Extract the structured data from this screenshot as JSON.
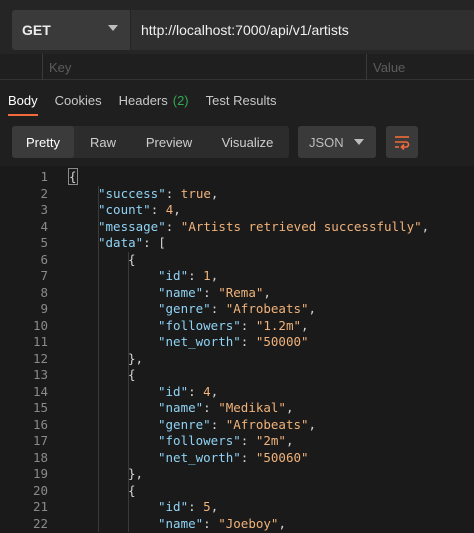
{
  "request": {
    "method": "GET",
    "url": "http://localhost:7000/api/v1/artists"
  },
  "params": {
    "key_placeholder": "Key",
    "value_placeholder": "Value"
  },
  "tabs": [
    {
      "label": "Body",
      "active": true
    },
    {
      "label": "Cookies",
      "active": false
    },
    {
      "label": "Headers",
      "count": "(2)",
      "active": false
    },
    {
      "label": "Test Results",
      "active": false
    }
  ],
  "view_modes": [
    {
      "label": "Pretty",
      "active": true
    },
    {
      "label": "Raw",
      "active": false
    },
    {
      "label": "Preview",
      "active": false
    },
    {
      "label": "Visualize",
      "active": false
    }
  ],
  "format": {
    "selected": "JSON"
  },
  "colors": {
    "accent": "#f26b3a",
    "headers_count": "#34a853",
    "json_key": "#8fd3f4",
    "json_value": "#f0b27a"
  },
  "icons": {
    "wrap": "wrap-lines-icon",
    "method_dropdown": "chevron-down-icon",
    "format_dropdown": "chevron-down-icon"
  },
  "code_lines": [
    {
      "n": "1",
      "indent": 0,
      "parts": [
        [
          "p",
          "{"
        ]
      ]
    },
    {
      "n": "2",
      "indent": 1,
      "parts": [
        [
          "k",
          "\"success\""
        ],
        [
          "p",
          ": "
        ],
        [
          "b",
          "true"
        ],
        [
          "p",
          ","
        ]
      ]
    },
    {
      "n": "3",
      "indent": 1,
      "parts": [
        [
          "k",
          "\"count\""
        ],
        [
          "p",
          ": "
        ],
        [
          "n",
          "4"
        ],
        [
          "p",
          ","
        ]
      ]
    },
    {
      "n": "4",
      "indent": 1,
      "parts": [
        [
          "k",
          "\"message\""
        ],
        [
          "p",
          ": "
        ],
        [
          "s",
          "\"Artists retrieved successfully\""
        ],
        [
          "p",
          ","
        ]
      ]
    },
    {
      "n": "5",
      "indent": 1,
      "parts": [
        [
          "k",
          "\"data\""
        ],
        [
          "p",
          ": ["
        ]
      ]
    },
    {
      "n": "6",
      "indent": 2,
      "parts": [
        [
          "p",
          "{"
        ]
      ]
    },
    {
      "n": "7",
      "indent": 3,
      "parts": [
        [
          "k",
          "\"id\""
        ],
        [
          "p",
          ": "
        ],
        [
          "n",
          "1"
        ],
        [
          "p",
          ","
        ]
      ]
    },
    {
      "n": "8",
      "indent": 3,
      "parts": [
        [
          "k",
          "\"name\""
        ],
        [
          "p",
          ": "
        ],
        [
          "s",
          "\"Rema\""
        ],
        [
          "p",
          ","
        ]
      ]
    },
    {
      "n": "9",
      "indent": 3,
      "parts": [
        [
          "k",
          "\"genre\""
        ],
        [
          "p",
          ": "
        ],
        [
          "s",
          "\"Afrobeats\""
        ],
        [
          "p",
          ","
        ]
      ]
    },
    {
      "n": "10",
      "indent": 3,
      "parts": [
        [
          "k",
          "\"followers\""
        ],
        [
          "p",
          ": "
        ],
        [
          "s",
          "\"1.2m\""
        ],
        [
          "p",
          ","
        ]
      ]
    },
    {
      "n": "11",
      "indent": 3,
      "parts": [
        [
          "k",
          "\"net_worth\""
        ],
        [
          "p",
          ": "
        ],
        [
          "s",
          "\"50000\""
        ]
      ]
    },
    {
      "n": "12",
      "indent": 2,
      "parts": [
        [
          "p",
          "},"
        ]
      ]
    },
    {
      "n": "13",
      "indent": 2,
      "parts": [
        [
          "p",
          "{"
        ]
      ]
    },
    {
      "n": "14",
      "indent": 3,
      "parts": [
        [
          "k",
          "\"id\""
        ],
        [
          "p",
          ": "
        ],
        [
          "n",
          "4"
        ],
        [
          "p",
          ","
        ]
      ]
    },
    {
      "n": "15",
      "indent": 3,
      "parts": [
        [
          "k",
          "\"name\""
        ],
        [
          "p",
          ": "
        ],
        [
          "s",
          "\"Medikal\""
        ],
        [
          "p",
          ","
        ]
      ]
    },
    {
      "n": "16",
      "indent": 3,
      "parts": [
        [
          "k",
          "\"genre\""
        ],
        [
          "p",
          ": "
        ],
        [
          "s",
          "\"Afrobeats\""
        ],
        [
          "p",
          ","
        ]
      ]
    },
    {
      "n": "17",
      "indent": 3,
      "parts": [
        [
          "k",
          "\"followers\""
        ],
        [
          "p",
          ": "
        ],
        [
          "s",
          "\"2m\""
        ],
        [
          "p",
          ","
        ]
      ]
    },
    {
      "n": "18",
      "indent": 3,
      "parts": [
        [
          "k",
          "\"net_worth\""
        ],
        [
          "p",
          ": "
        ],
        [
          "s",
          "\"50060\""
        ]
      ]
    },
    {
      "n": "19",
      "indent": 2,
      "parts": [
        [
          "p",
          "},"
        ]
      ]
    },
    {
      "n": "20",
      "indent": 2,
      "parts": [
        [
          "p",
          "{"
        ]
      ]
    },
    {
      "n": "21",
      "indent": 3,
      "parts": [
        [
          "k",
          "\"id\""
        ],
        [
          "p",
          ": "
        ],
        [
          "n",
          "5"
        ],
        [
          "p",
          ","
        ]
      ]
    },
    {
      "n": "22",
      "indent": 3,
      "parts": [
        [
          "k",
          "\"name\""
        ],
        [
          "p",
          ": "
        ],
        [
          "s",
          "\"Joeboy\""
        ],
        [
          "p",
          ","
        ]
      ]
    }
  ]
}
